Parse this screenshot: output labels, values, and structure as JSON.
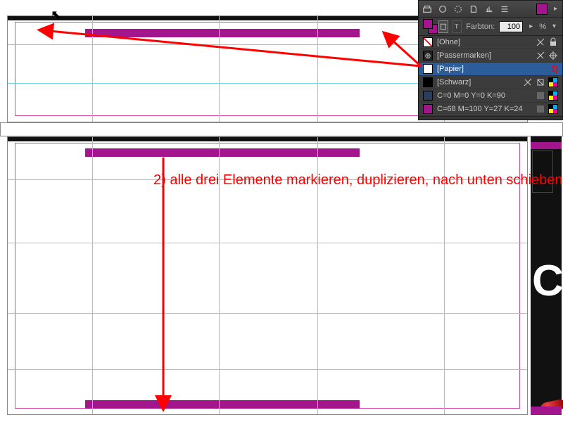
{
  "panel": {
    "farbton_label": "Farbton:",
    "farbton_value": "100",
    "percent_suffix": "%",
    "rows": [
      {
        "label": "[Ohne]"
      },
      {
        "label": "[Passermarken]"
      },
      {
        "label": "[Papier]",
        "annotation": "1)"
      },
      {
        "label": "[Schwarz]"
      },
      {
        "label": "C=0 M=0 Y=0 K=90"
      },
      {
        "label": "C=68 M=100 Y=27 K=24"
      }
    ]
  },
  "annotation_step2": "2) alle drei Elemente markieren, duplizieren, nach unten schieben",
  "preview": {
    "big_letter": "C"
  }
}
